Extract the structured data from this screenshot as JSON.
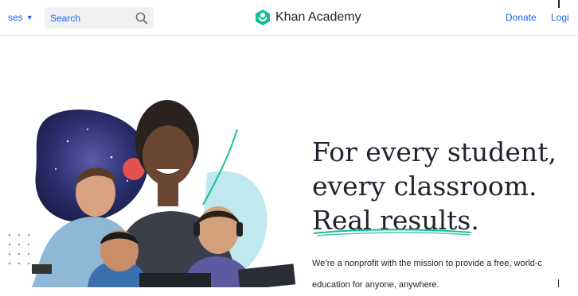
{
  "nav": {
    "courses_label": "ses",
    "search_placeholder": "Search",
    "logo_text": "Khan Academy",
    "donate_label": "Donate",
    "login_label": "Logi"
  },
  "hero": {
    "headline_line1": "For every student,",
    "headline_line2": "every classroom.",
    "headline_line3": "Real results.",
    "sub_line1": "We’re a nonprofit with the mission to provide a free, world-c",
    "sub_line2": "education for anyone, anywhere."
  },
  "colors": {
    "accent_blue": "#1865f2",
    "brand_green": "#14bf96",
    "text_dark": "#21242c"
  },
  "icons": {
    "search": "search-icon",
    "logo": "khan-academy-logo-icon",
    "dropdown": "chevron-down-icon"
  }
}
